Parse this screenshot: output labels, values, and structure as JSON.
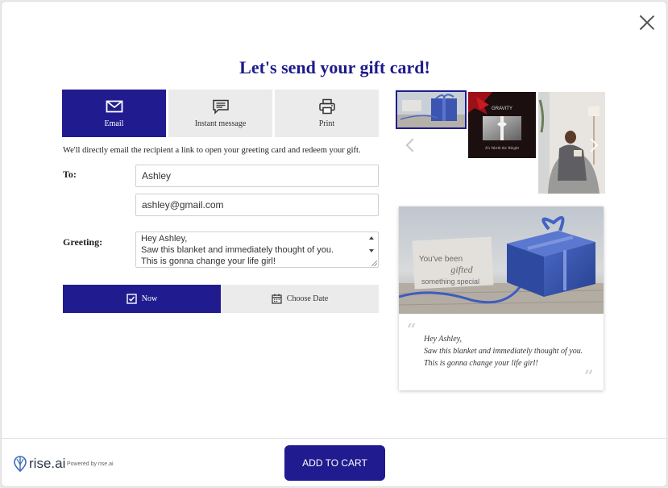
{
  "header": {
    "title": "Let's send your gift card!"
  },
  "delivery_tabs": [
    {
      "label": "Email",
      "icon": "envelope-icon",
      "active": true
    },
    {
      "label": "Instant message",
      "icon": "message-icon",
      "active": false
    },
    {
      "label": "Print",
      "icon": "printer-icon",
      "active": false
    }
  ],
  "description": "We'll directly email the recipient a link to open your greeting card and redeem your gift.",
  "form": {
    "to_label": "To:",
    "name_value": "Ashley",
    "email_value": "ashley@gmail.com",
    "greeting_label": "Greeting:",
    "greeting_value": "Hey Ashley,\nSaw this blanket and immediately thought of you.\nThis is gonna change your life girl!"
  },
  "schedule": {
    "now_label": "Now",
    "choose_date_label": "Choose Date",
    "selected": "Now"
  },
  "thumbnails": [
    {
      "name": "blue-gift-box",
      "selected": true
    },
    {
      "name": "gravity-card",
      "brand": "GRAVITY",
      "tagline": "It's Worth the Weight",
      "selected": false
    },
    {
      "name": "woman-in-blanket",
      "selected": false
    }
  ],
  "preview": {
    "image_text_line1": "You've been",
    "image_text_line2": "gifted",
    "image_text_line3": "something special",
    "message": "Hey Ashley,\nSaw this blanket and immediately thought of you.\nThis is gonna change your life girl!"
  },
  "footer": {
    "logo_text": "rise.ai",
    "powered_by": "Powered by rise.ai",
    "add_to_cart": "ADD TO CART"
  },
  "colors": {
    "brand": "#201c8f",
    "title": "#1d1a8c",
    "tab_inactive": "#ebebeb"
  }
}
